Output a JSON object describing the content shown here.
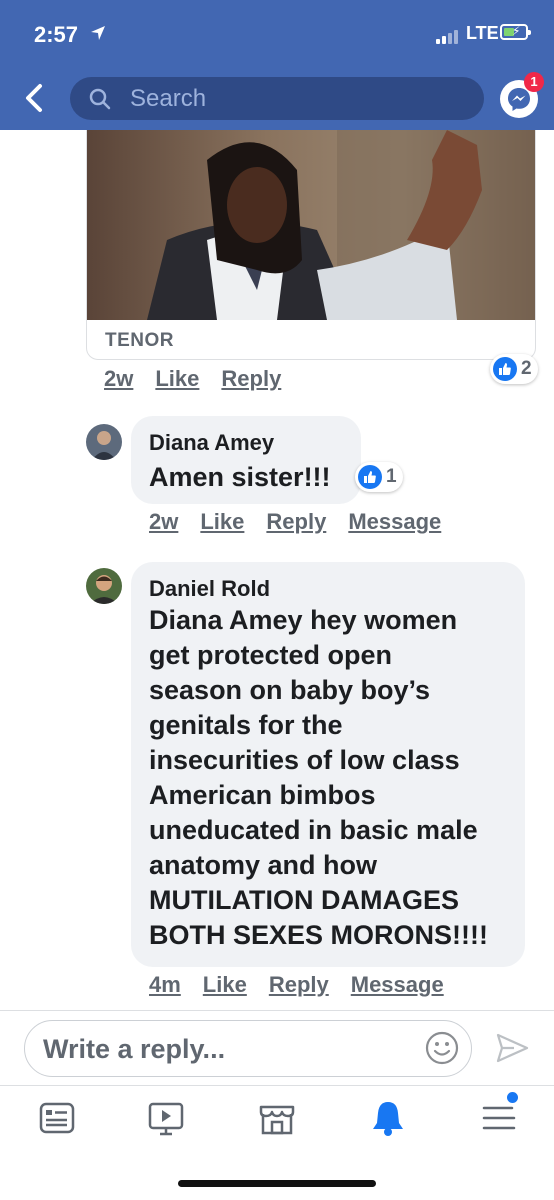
{
  "status_bar": {
    "time": "2:57",
    "network": "LTE"
  },
  "header": {
    "search_placeholder": "Search",
    "messenger_badge": "1"
  },
  "gif_card": {
    "source": "TENOR"
  },
  "top_actions": {
    "time_ago": "2w",
    "like": "Like",
    "reply": "Reply",
    "reaction_count": "2"
  },
  "comments": [
    {
      "author": "Diana Amey",
      "lines": [
        "Amen sister!!!"
      ],
      "reaction_count": "1",
      "time_ago": "2w",
      "like": "Like",
      "reply": "Reply",
      "message": "Message"
    },
    {
      "author": "Daniel Rold",
      "lines": [
        "Diana Amey hey women",
        "get protected open",
        "season on baby boy’s",
        "genitals for the",
        "insecurities of low class",
        "American bimbos",
        "uneducated in basic male",
        "anatomy and how",
        "MUTILATION DAMAGES",
        "BOTH SEXES MORONS!!!!"
      ],
      "time_ago": "4m",
      "like": "Like",
      "reply": "Reply",
      "message": "Message"
    }
  ],
  "composer": {
    "placeholder": "Write a reply..."
  },
  "colors": {
    "brand": "#4267b2",
    "like_blue": "#1877f2",
    "badge_red": "#f02849",
    "bubble_gray": "#f0f2f5"
  },
  "icons": {
    "back": "chevron-left-icon",
    "search": "search-icon",
    "messenger": "messenger-icon",
    "emoji": "emoji-icon",
    "send": "send-icon",
    "tabs": [
      "news-feed-icon",
      "watch-icon",
      "marketplace-icon",
      "notifications-icon",
      "menu-icon"
    ]
  }
}
